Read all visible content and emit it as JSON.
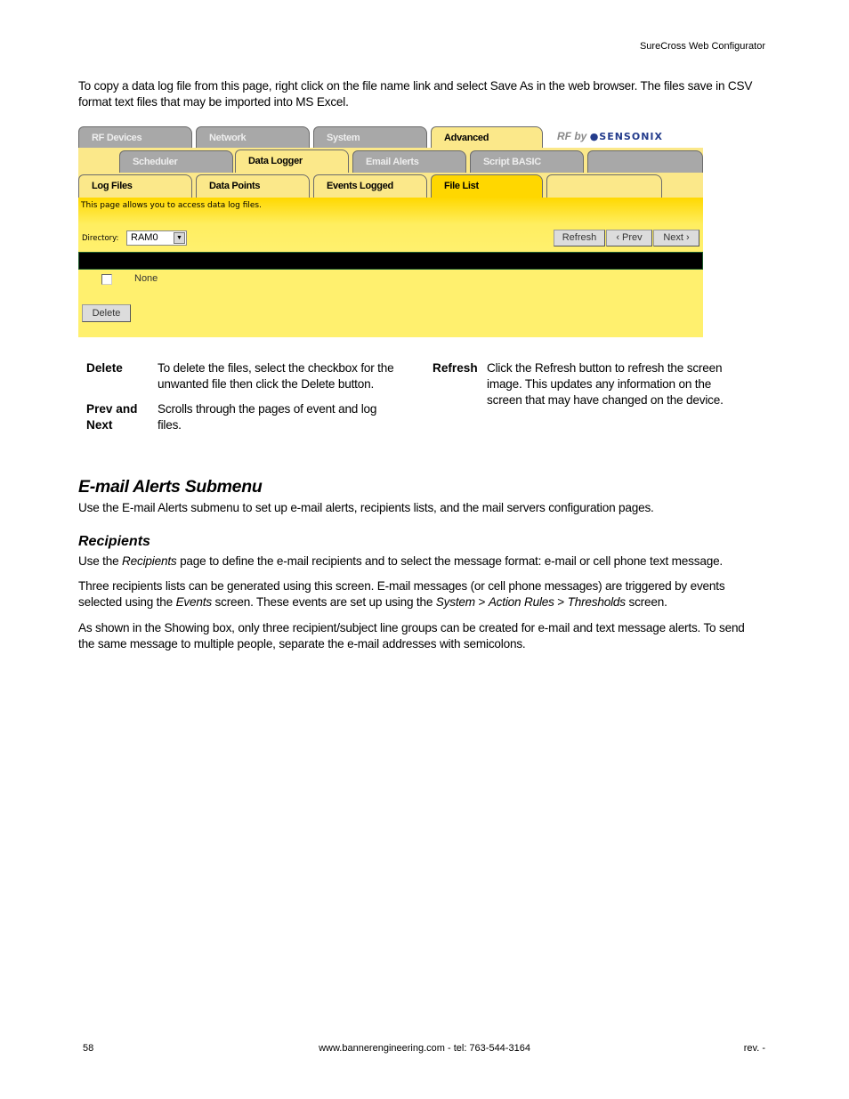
{
  "header": {
    "doc_title": "SureCross Web Configurator"
  },
  "intro": "To copy a data log file from this page, right click on the file name link and select Save As in the web browser. The files save in CSV format text files that may be imported into MS Excel.",
  "screenshot": {
    "tabs_row1": [
      {
        "label": "RF Devices",
        "state": "inactive"
      },
      {
        "label": "Network",
        "state": "inactive"
      },
      {
        "label": "System",
        "state": "inactive"
      },
      {
        "label": "Advanced",
        "state": "active"
      }
    ],
    "logo": {
      "prefix": "RF by",
      "brand": "●SENSONIX"
    },
    "tabs_row2": [
      {
        "label": "Scheduler",
        "state": "inactive"
      },
      {
        "label": "Data Logger",
        "state": "active"
      },
      {
        "label": "Email Alerts",
        "state": "inactive"
      },
      {
        "label": "Script BASIC",
        "state": "inactive"
      },
      {
        "label": "",
        "state": "inactive"
      }
    ],
    "tabs_row3": [
      {
        "label": "Log Files",
        "state": "inactive"
      },
      {
        "label": "Data Points",
        "state": "inactive"
      },
      {
        "label": "Events Logged",
        "state": "inactive"
      },
      {
        "label": "File List",
        "state": "active"
      },
      {
        "label": "",
        "state": "inactive"
      }
    ],
    "description": "This page allows you to access data log files.",
    "directory_label": "Directory:",
    "directory_value": "RAM0",
    "buttons": {
      "refresh": "Refresh",
      "prev": "‹ Prev",
      "next": "Next ›",
      "delete": "Delete"
    },
    "file_row": {
      "checked": false,
      "name": "None"
    },
    "colors": {
      "panel": "#fff06e",
      "active_tab": "#ffd700",
      "inactive_tab": "#a8a8a8"
    }
  },
  "definitions": [
    {
      "term": "Delete",
      "desc": "To delete the files, select the checkbox for the unwanted file then click the Delete button."
    },
    {
      "term": "Prev and Next",
      "desc": "Scrolls through the pages of event and log files."
    },
    {
      "term": "Refresh",
      "desc": "Click the Refresh button to refresh the screen image. This updates any information on the screen that may have changed on the device."
    }
  ],
  "section": {
    "title": "E-mail Alerts Submenu",
    "intro": "Use the E-mail Alerts submenu to set up e-mail alerts, recipients lists, and the mail servers configuration pages.",
    "subsection": {
      "title": "Recipients",
      "p1": {
        "a": "Use the ",
        "em": "Recipients",
        "b": " page to define the e-mail recipients and to select the message format: e-mail or cell phone text message."
      },
      "p2": {
        "a": "Three recipients lists can be generated using this screen. E-mail messages (or cell phone messages) are triggered by events selected using the ",
        "em1": "Events",
        "b": " screen. These events are set up using the ",
        "em2": "System",
        "sep1": " > ",
        "em3": "Action Rules",
        "sep2": " > ",
        "em4": "Thresholds",
        "c": " screen."
      },
      "p3": "As shown in the Showing box, only three recipient/subject line groups can be created for e-mail and text message alerts. To send the same message to multiple people, separate the e-mail addresses with semicolons."
    }
  },
  "footer": {
    "page_number": "58",
    "contact": "www.bannerengineering.com - tel: 763-544-3164",
    "revision": "rev. -"
  }
}
